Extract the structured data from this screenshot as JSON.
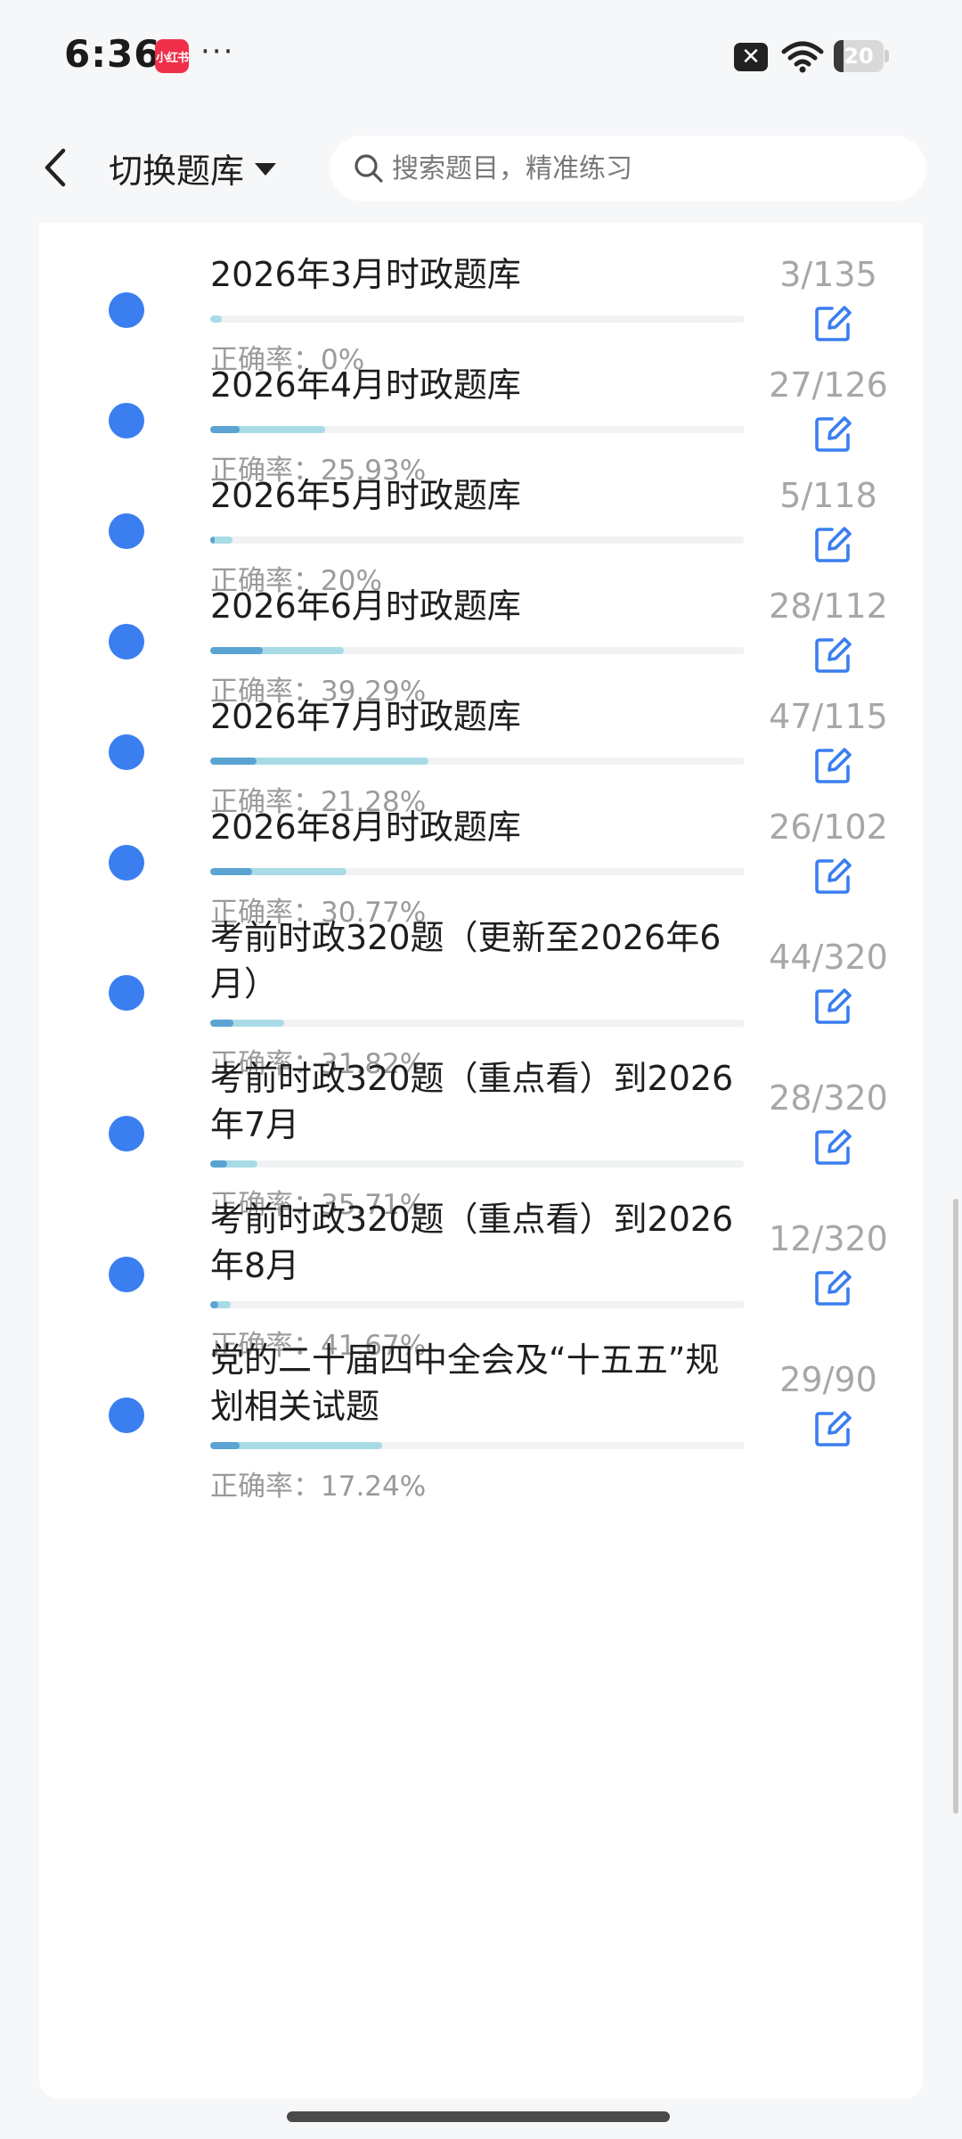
{
  "status": {
    "time": "6:36",
    "app_badge": "小红书",
    "more": "···",
    "sim": "✕",
    "battery": "20",
    "battery_level": 0.2
  },
  "header": {
    "back_icon": "chevron-left-icon",
    "title": "切换题库",
    "search_placeholder": "搜索题目，精准练习"
  },
  "colors": {
    "accent": "#3a7ef0",
    "progress": "#a9dbe6",
    "progress_correct": "#5aa3d3",
    "edit_icon": "#3a7ef0"
  },
  "accuracy_label": "正确率：",
  "items": [
    {
      "title": "2026年3月时政题库",
      "count": "3/135",
      "accuracy": "0%",
      "done": 3,
      "total": 135,
      "rate": 0
    },
    {
      "title": "2026年4月时政题库",
      "count": "27/126",
      "accuracy": "25.93%",
      "done": 27,
      "total": 126,
      "rate": 0.2593
    },
    {
      "title": "2026年5月时政题库",
      "count": "5/118",
      "accuracy": "20%",
      "done": 5,
      "total": 118,
      "rate": 0.2
    },
    {
      "title": "2026年6月时政题库",
      "count": "28/112",
      "accuracy": "39.29%",
      "done": 28,
      "total": 112,
      "rate": 0.3929
    },
    {
      "title": "2026年7月时政题库",
      "count": "47/115",
      "accuracy": "21.28%",
      "done": 47,
      "total": 115,
      "rate": 0.2128
    },
    {
      "title": "2026年8月时政题库",
      "count": "26/102",
      "accuracy": "30.77%",
      "done": 26,
      "total": 102,
      "rate": 0.3077
    },
    {
      "title": "考前时政320题（更新至2026年6月）",
      "count": "44/320",
      "accuracy": "31.82%",
      "done": 44,
      "total": 320,
      "rate": 0.3182
    },
    {
      "title": "考前时政320题（重点看）到2026年7月",
      "count": "28/320",
      "accuracy": "35.71%",
      "done": 28,
      "total": 320,
      "rate": 0.3571
    },
    {
      "title": "考前时政320题（重点看）到2026年8月",
      "count": "12/320",
      "accuracy": "41.67%",
      "done": 12,
      "total": 320,
      "rate": 0.4167
    },
    {
      "title": "党的二十届四中全会及“十五五”规划相关试题",
      "count": "29/90",
      "accuracy": "17.24%",
      "done": 29,
      "total": 90,
      "rate": 0.1724
    }
  ]
}
